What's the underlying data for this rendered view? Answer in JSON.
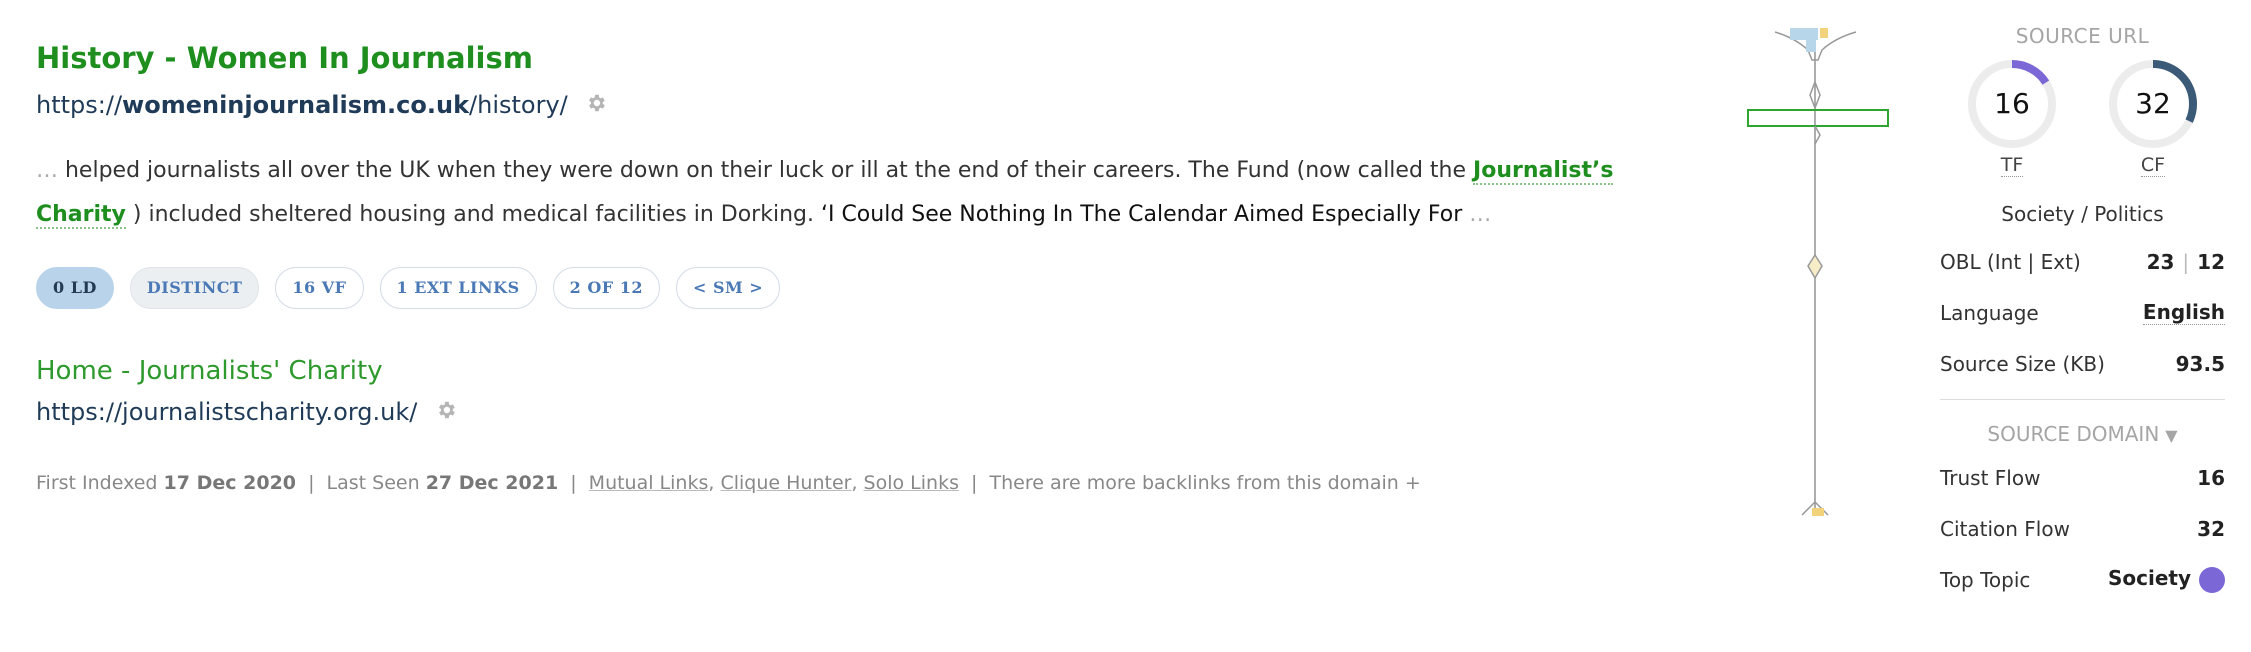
{
  "result1": {
    "title": "History - Women In Journalism",
    "url_prefix": "https://",
    "url_domain": "womeninjournalism.co.uk",
    "url_path": "/history/",
    "snippet_lead_ellipsis": "…",
    "snippet_before": " helped journalists all over the UK when they were down on their luck or ill at the end of their careers. The Fund (now called the ",
    "anchor_text": "Journalist’s Charity",
    "snippet_after": " ) included sheltered housing and medical facilities in Dorking. ",
    "snippet_quote": "‘I Could See Nothing In The Calendar Aimed Especially For",
    "snippet_trail_ellipsis": " …",
    "pills": [
      "0 LD",
      "DISTINCT",
      "16 VF",
      "1 EXT LINKS",
      "2 OF 12",
      "< SM >"
    ]
  },
  "result2": {
    "title": "Home - Journalists' Charity",
    "url": "https://journalistscharity.org.uk/"
  },
  "meta": {
    "first_indexed_label": "First Indexed",
    "first_indexed": "17 Dec 2020",
    "sep": "|",
    "last_seen_label": "Last Seen",
    "last_seen": "27 Dec 2021",
    "mutual_links": "Mutual Links",
    "clique_hunter": "Clique Hunter",
    "solo_links": "Solo Links",
    "comma": ",",
    "more_backlinks": "There are more backlinks from this domain +"
  },
  "panel": {
    "source_url_head": "SOURCE URL",
    "tf_value": "16",
    "tf_label": "TF",
    "tf_fraction": 0.16,
    "cf_value": "32",
    "cf_label": "CF",
    "cf_fraction": 0.32,
    "topic": "Society / Politics",
    "obl_label": "OBL (Int | Ext)",
    "obl_int": "23",
    "obl_sep": "|",
    "obl_ext": "12",
    "language_label": "Language",
    "language": "English",
    "size_label": "Source Size (KB)",
    "size": "93.5",
    "source_domain_head": "SOURCE DOMAIN",
    "trust_flow_label": "Trust Flow",
    "trust_flow": "16",
    "citation_flow_label": "Citation Flow",
    "citation_flow": "32",
    "top_topic_label": "Top Topic",
    "top_topic": "Society"
  },
  "colors": {
    "title_green": "#1e8f1e",
    "tf_arc": "#7b68d6",
    "cf_arc": "#3a5a78",
    "dial_track": "#ececec",
    "topic_dot": "#7b68d6",
    "chain_box": "#2ea52e"
  },
  "icons": {
    "gear": "gear-icon",
    "dropdown": "triangle-down-icon"
  }
}
